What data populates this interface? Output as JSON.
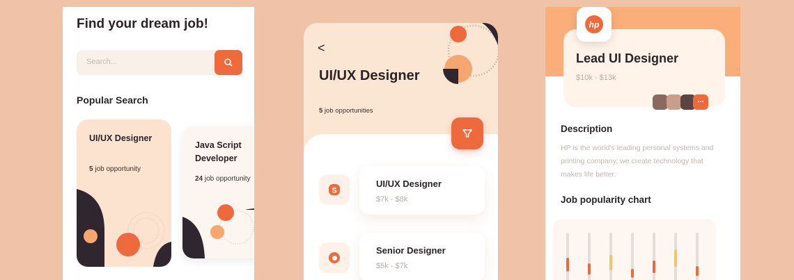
{
  "screen1": {
    "title": "Find your dream job!",
    "search_placeholder": "Search...",
    "popular_label": "Popular Search",
    "cards": [
      {
        "title": "UI/UX Designer",
        "count": "5",
        "count_suffix": " job opportunity"
      },
      {
        "title": "Java Script Developer",
        "count": "24",
        "count_suffix": " job opportunity"
      }
    ]
  },
  "screen2": {
    "back": "<",
    "title": "UI/UX Designer",
    "count": "5",
    "count_suffix": " job opportunities",
    "jobs": [
      {
        "title": "UI/UX Designer",
        "salary": "$7k - $8k",
        "logo": "skype-logo"
      },
      {
        "title": "Senior Designer",
        "salary": "$5k - $7k",
        "logo": "vodafone-logo"
      }
    ]
  },
  "screen3": {
    "company_logo": "hp",
    "job_title": "Lead UI Designer",
    "salary": "$10k - $13k",
    "more_badge": "...",
    "description_label": "Description",
    "description": "HP is the world's leading personal systems and printing company, we create technology that makes life better.",
    "chart_label": "Job popularity chart",
    "chart_levels": [
      0.55,
      0.45,
      0.6,
      0.35,
      0.5,
      0.7,
      0.4
    ]
  },
  "colors": {
    "background": "#f0c3a8",
    "accent": "#ee6a3d",
    "peach": "#fbe3cf",
    "dark": "#2a2428",
    "light_orange": "#fbae79"
  }
}
